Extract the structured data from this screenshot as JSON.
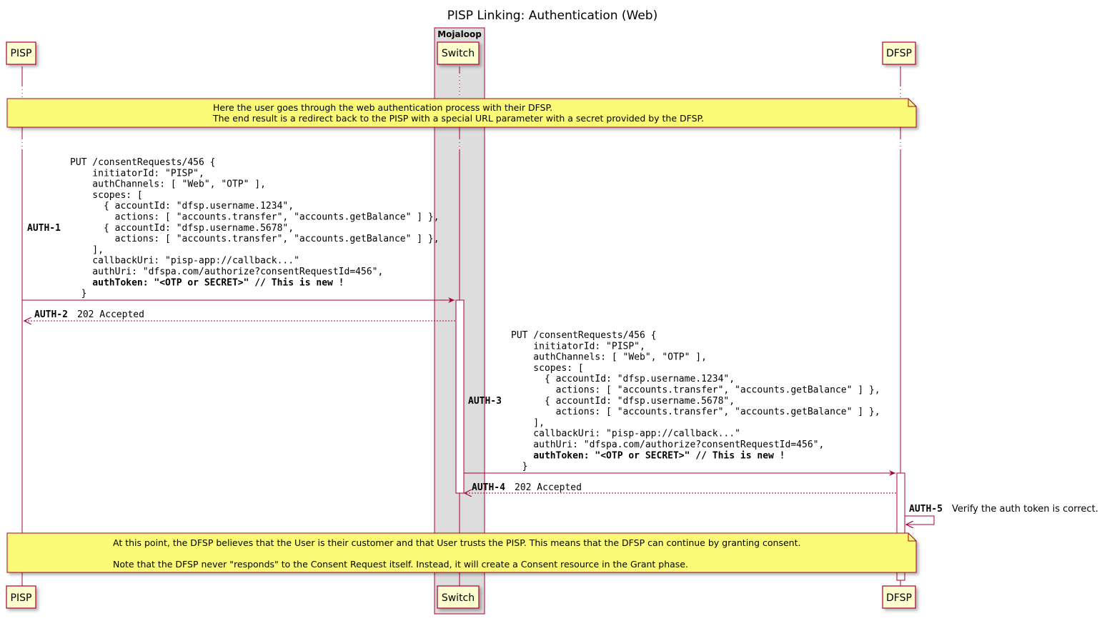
{
  "title": "PISP Linking: Authentication (Web)",
  "group_label": "Mojaloop",
  "participants": {
    "pisp": "PISP",
    "switch": "Switch",
    "dfsp": "DFSP"
  },
  "note1": {
    "line1": "Here the user goes through the web authentication process with their DFSP.",
    "line2": "The end result is a redirect back to the PISP with a special URL parameter with a secret provided by the DFSP."
  },
  "auth1": {
    "id": "AUTH-1",
    "lines": [
      "PUT /consentRequests/456 {",
      "    initiatorId: \"PISP\",",
      "    authChannels: [ \"Web\", \"OTP\" ],",
      "    scopes: [",
      "      { accountId: \"dfsp.username.1234\",",
      "        actions: [ \"accounts.transfer\", \"accounts.getBalance\" ] },",
      "      { accountId: \"dfsp.username.5678\",",
      "        actions: [ \"accounts.transfer\", \"accounts.getBalance\" ] },",
      "    ],",
      "    callbackUri: \"pisp-app://callback...\"",
      "    authUri: \"dfspa.com/authorize?consentRequestId=456\","
    ],
    "bold_line": "    authToken: \"<OTP or SECRET>\" // This is new !",
    "closing": "  }"
  },
  "auth2": {
    "id": "AUTH-2",
    "text": "202 Accepted"
  },
  "auth3": {
    "id": "AUTH-3",
    "lines": [
      "PUT /consentRequests/456 {",
      "    initiatorId: \"PISP\",",
      "    authChannels: [ \"Web\", \"OTP\" ],",
      "    scopes: [",
      "      { accountId: \"dfsp.username.1234\",",
      "        actions: [ \"accounts.transfer\", \"accounts.getBalance\" ] },",
      "      { accountId: \"dfsp.username.5678\",",
      "        actions: [ \"accounts.transfer\", \"accounts.getBalance\" ] },",
      "    ],",
      "    callbackUri: \"pisp-app://callback...\"",
      "    authUri: \"dfspa.com/authorize?consentRequestId=456\","
    ],
    "bold_line": "    authToken: \"<OTP or SECRET>\" // This is new !",
    "closing": "  }"
  },
  "auth4": {
    "id": "AUTH-4",
    "text": "202 Accepted"
  },
  "auth5": {
    "id": "AUTH-5",
    "text": "Verify the auth token is correct."
  },
  "note2": {
    "line1": "At this point, the DFSP believes that the User is their customer and that User trusts the PISP. This means that the DFSP can continue by granting consent.",
    "line2": "Note that the DFSP never \"responds\" to the Consent Request itself. Instead, it will create a Consent resource in the Grant phase."
  },
  "colors": {
    "participant_fill": "#FEFECE",
    "line": "#A80036",
    "group_fill": "#DDDDDD",
    "note_fill": "#FBFB77"
  }
}
